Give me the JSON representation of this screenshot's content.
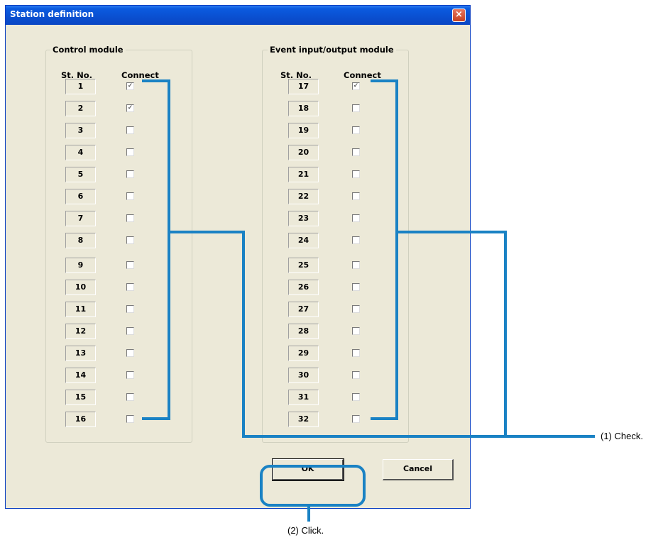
{
  "window": {
    "title": "Station definition",
    "close_glyph": "×"
  },
  "left_group": {
    "label": "Control module",
    "col_st": "St. No.",
    "col_connect": "Connect",
    "stations": [
      {
        "no": "1",
        "checked": true
      },
      {
        "no": "2",
        "checked": true
      },
      {
        "no": "3",
        "checked": false
      },
      {
        "no": "4",
        "checked": false
      },
      {
        "no": "5",
        "checked": false
      },
      {
        "no": "6",
        "checked": false
      },
      {
        "no": "7",
        "checked": false
      },
      {
        "no": "8",
        "checked": false
      },
      {
        "no": "9",
        "checked": false
      },
      {
        "no": "10",
        "checked": false
      },
      {
        "no": "11",
        "checked": false
      },
      {
        "no": "12",
        "checked": false
      },
      {
        "no": "13",
        "checked": false
      },
      {
        "no": "14",
        "checked": false
      },
      {
        "no": "15",
        "checked": false
      },
      {
        "no": "16",
        "checked": false
      }
    ]
  },
  "right_group": {
    "label": "Event input/output module",
    "col_st": "St. No.",
    "col_connect": "Connect",
    "stations": [
      {
        "no": "17",
        "checked": true
      },
      {
        "no": "18",
        "checked": false
      },
      {
        "no": "19",
        "checked": false
      },
      {
        "no": "20",
        "checked": false
      },
      {
        "no": "21",
        "checked": false
      },
      {
        "no": "22",
        "checked": false
      },
      {
        "no": "23",
        "checked": false
      },
      {
        "no": "24",
        "checked": false
      },
      {
        "no": "25",
        "checked": false
      },
      {
        "no": "26",
        "checked": false
      },
      {
        "no": "27",
        "checked": false
      },
      {
        "no": "28",
        "checked": false
      },
      {
        "no": "29",
        "checked": false
      },
      {
        "no": "30",
        "checked": false
      },
      {
        "no": "31",
        "checked": false
      },
      {
        "no": "32",
        "checked": false
      }
    ]
  },
  "buttons": {
    "ok": "OK",
    "cancel": "Cancel"
  },
  "annotations": {
    "check": "(1) Check.",
    "click": "(2) Click."
  },
  "colors": {
    "annotation": "#1a82c4",
    "titlebar": "#0a4fd0",
    "dialog_bg": "#ece9d8"
  },
  "icons": {
    "close": "close-icon",
    "check_mark": "✓"
  }
}
